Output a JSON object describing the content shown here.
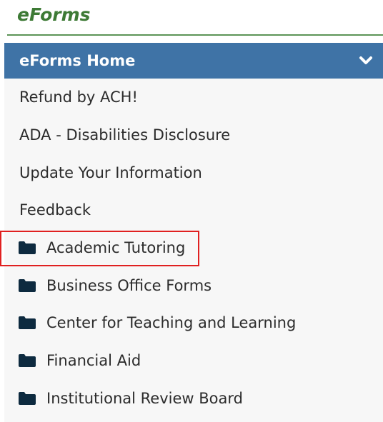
{
  "app": {
    "title": "eForms"
  },
  "panel": {
    "header_label": "eForms Home",
    "header_icon": "chevron-down-icon",
    "links": [
      {
        "label": "Refund by ACH!"
      },
      {
        "label": "ADA - Disabilities Disclosure"
      },
      {
        "label": "Update Your Information"
      },
      {
        "label": "Feedback"
      }
    ],
    "folders": [
      {
        "label": "Academic Tutoring",
        "icon": "folder-icon",
        "highlighted": true
      },
      {
        "label": "Business Office Forms",
        "icon": "folder-icon"
      },
      {
        "label": "Center for Teaching and Learning",
        "icon": "folder-icon"
      },
      {
        "label": "Financial Aid",
        "icon": "folder-icon"
      },
      {
        "label": "Institutional Review Board",
        "icon": "folder-icon"
      }
    ]
  },
  "colors": {
    "title_green": "#3d7a35",
    "header_blue": "#3f73a6",
    "folder_icon": "#0d2a3f",
    "highlight_border": "#e02020"
  }
}
